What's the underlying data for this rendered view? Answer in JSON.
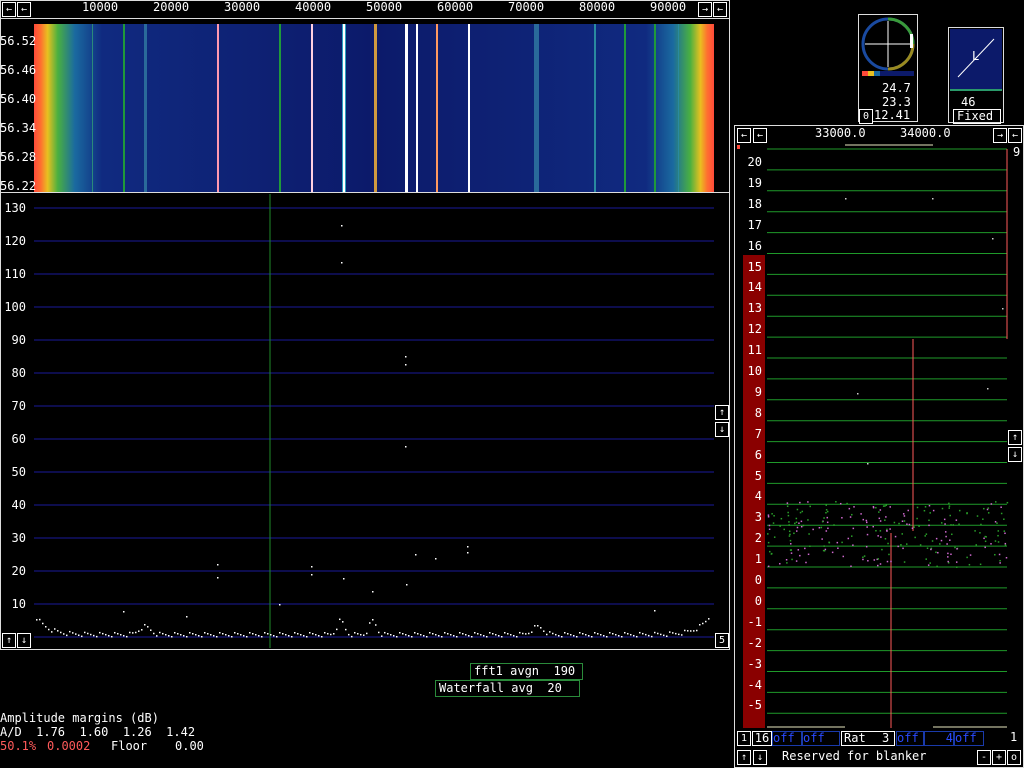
{
  "main_spectrum": {
    "freq_ticks": [
      "10000",
      "20000",
      "30000",
      "40000",
      "50000",
      "60000",
      "70000",
      "80000",
      "90000"
    ],
    "waterfall_time_labels": [
      "56.52",
      "56.46",
      "56.40",
      "56.34",
      "56.28",
      "56.22"
    ],
    "amplitude_ticks": [
      "130",
      "120",
      "110",
      "100",
      "90",
      "80",
      "70",
      "60",
      "50",
      "40",
      "30",
      "20",
      "10"
    ],
    "bottom_right_value": "5"
  },
  "averages": {
    "fft1": "fft1 avgn  190",
    "waterfall": "Waterfall avg  20"
  },
  "status": {
    "amp_title": "Amplitude margins (dB)",
    "ad_line": "A/D  1.76  1.60  1.26  1.42",
    "percent": "50.1%",
    "percent_value": "0.0002",
    "floor_label": "Floor",
    "floor_value": "0.00"
  },
  "polar_meter": {
    "v1": "24.7",
    "v2": "23.3",
    "v3": "12.41",
    "zero_btn": "0"
  },
  "fixed_meter": {
    "value": "46",
    "mode": "Fixed",
    "letter": "L"
  },
  "baseband": {
    "freq_ticks": [
      "33000.0",
      "34000.0"
    ],
    "right_number": "9",
    "scale_labels": [
      "20",
      "19",
      "18",
      "17",
      "16",
      "15",
      "14",
      "13",
      "12",
      "11",
      "10",
      "9",
      "8",
      "7",
      "6",
      "5",
      "4",
      "3",
      "2",
      "1",
      "0",
      "0",
      "-1",
      "-2",
      "-3",
      "-4",
      "-5"
    ],
    "controls": {
      "one": "1",
      "sixteen": "16",
      "off1": "off",
      "off2": "off",
      "rat_label": "Rat",
      "rat_value": "3",
      "off3": "off",
      "four": "4",
      "off4": "off",
      "right_one": "1"
    },
    "blanker_text": "Reserved for blanker",
    "btn_minus": "-",
    "btn_plus": "+",
    "btn_zero": "o"
  },
  "colors": {
    "grid_blue": "#1a1a9a",
    "grid_green": "#1f9a2a",
    "red_bar": "#8a0000",
    "accent_red": "#ff5a5a"
  }
}
